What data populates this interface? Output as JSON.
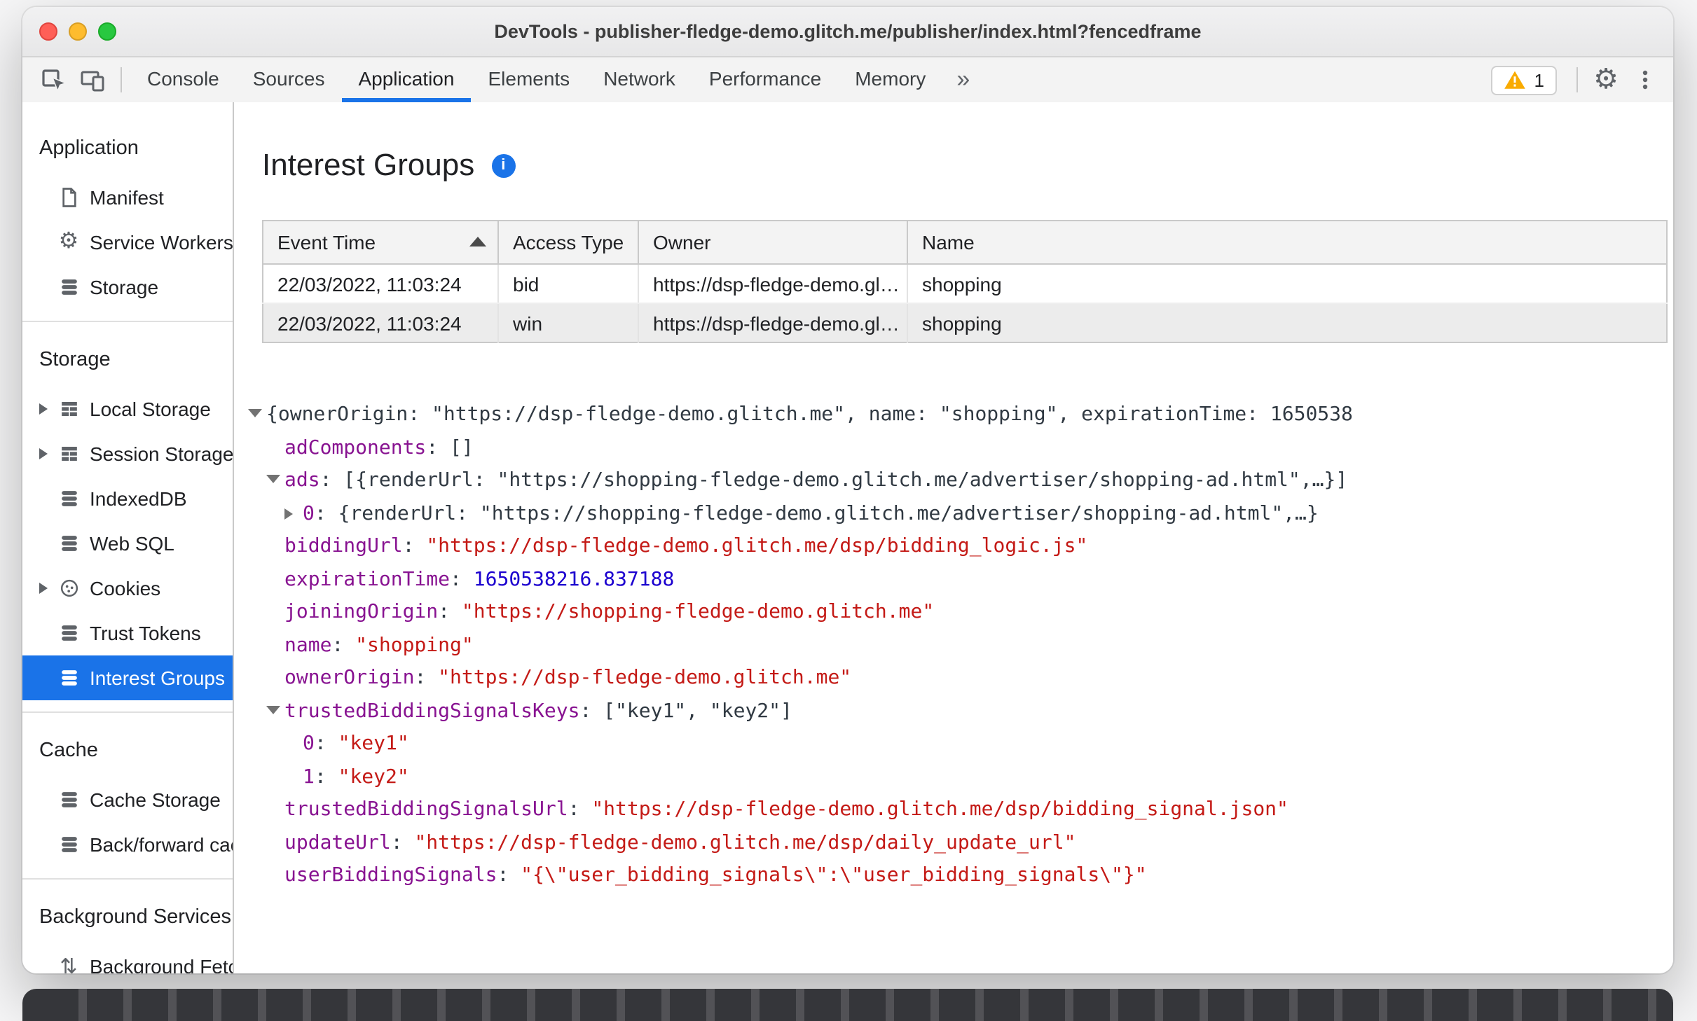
{
  "colors": {
    "accent": "#1a73e8",
    "json_key": "#881391",
    "json_string": "#c41a16",
    "json_number": "#1c00cf",
    "warning": "#f9ab00"
  },
  "window": {
    "title": "DevTools - publisher-fledge-demo.glitch.me/publisher/index.html?fencedframe"
  },
  "toolbar": {
    "tabs": [
      {
        "label": "Console"
      },
      {
        "label": "Sources"
      },
      {
        "label": "Application",
        "active": true
      },
      {
        "label": "Elements"
      },
      {
        "label": "Network"
      },
      {
        "label": "Performance"
      },
      {
        "label": "Memory"
      }
    ],
    "more_tabs": "»",
    "warning_count": "1"
  },
  "sidebar": {
    "sections": [
      {
        "title": "Application",
        "items": [
          {
            "label": "Manifest",
            "icon": "manifest"
          },
          {
            "label": "Service Workers",
            "icon": "gear"
          },
          {
            "label": "Storage",
            "icon": "database"
          }
        ]
      },
      {
        "title": "Storage",
        "items": [
          {
            "label": "Local Storage",
            "icon": "table",
            "expander": true
          },
          {
            "label": "Session Storage",
            "icon": "table",
            "expander": true
          },
          {
            "label": "IndexedDB",
            "icon": "database"
          },
          {
            "label": "Web SQL",
            "icon": "database"
          },
          {
            "label": "Cookies",
            "icon": "cookie",
            "expander": true
          },
          {
            "label": "Trust Tokens",
            "icon": "database"
          },
          {
            "label": "Interest Groups",
            "icon": "database",
            "selected": true
          }
        ]
      },
      {
        "title": "Cache",
        "items": [
          {
            "label": "Cache Storage",
            "icon": "database"
          },
          {
            "label": "Back/forward cach",
            "icon": "database"
          }
        ]
      },
      {
        "title": "Background Services",
        "items": [
          {
            "label": "Background Fetch",
            "icon": "fetch"
          }
        ]
      }
    ]
  },
  "main": {
    "heading": "Interest Groups",
    "table": {
      "columns": [
        "Event Time",
        "Access Type",
        "Owner",
        "Name"
      ],
      "sorted_column": "Event Time",
      "sort_direction": "ascending",
      "selected_row_index": 1,
      "rows": [
        [
          "22/03/2022, 11:03:24",
          "bid",
          "https://dsp-fledge-demo.gl…",
          "shopping"
        ],
        [
          "22/03/2022, 11:03:24",
          "win",
          "https://dsp-fledge-demo.gl…",
          "shopping"
        ]
      ]
    },
    "tree": [
      {
        "indent": 0,
        "expander": "down",
        "segments": [
          {
            "t": "plain",
            "v": "{ownerOrigin: \"https://dsp-fledge-demo.glitch.me\", name: \"shopping\", expirationTime: 1650538"
          }
        ]
      },
      {
        "indent": 1,
        "expander": null,
        "segments": [
          {
            "t": "key",
            "v": "adComponents"
          },
          {
            "t": "plain",
            "v": ": []"
          }
        ]
      },
      {
        "indent": 1,
        "expander": "down",
        "segments": [
          {
            "t": "key",
            "v": "ads"
          },
          {
            "t": "plain",
            "v": ": [{renderUrl: \"https://shopping-fledge-demo.glitch.me/advertiser/shopping-ad.html\",…}]"
          }
        ]
      },
      {
        "indent": 2,
        "expander": "right",
        "segments": [
          {
            "t": "key",
            "v": "0"
          },
          {
            "t": "plain",
            "v": ": {renderUrl: \"https://shopping-fledge-demo.glitch.me/advertiser/shopping-ad.html\",…}"
          }
        ]
      },
      {
        "indent": 1,
        "expander": null,
        "segments": [
          {
            "t": "key",
            "v": "biddingUrl"
          },
          {
            "t": "plain",
            "v": ": "
          },
          {
            "t": "string",
            "v": "\"https://dsp-fledge-demo.glitch.me/dsp/bidding_logic.js\""
          }
        ]
      },
      {
        "indent": 1,
        "expander": null,
        "segments": [
          {
            "t": "key",
            "v": "expirationTime"
          },
          {
            "t": "plain",
            "v": ": "
          },
          {
            "t": "number",
            "v": "1650538216.837188"
          }
        ]
      },
      {
        "indent": 1,
        "expander": null,
        "segments": [
          {
            "t": "key",
            "v": "joiningOrigin"
          },
          {
            "t": "plain",
            "v": ": "
          },
          {
            "t": "string",
            "v": "\"https://shopping-fledge-demo.glitch.me\""
          }
        ]
      },
      {
        "indent": 1,
        "expander": null,
        "segments": [
          {
            "t": "key",
            "v": "name"
          },
          {
            "t": "plain",
            "v": ": "
          },
          {
            "t": "string",
            "v": "\"shopping\""
          }
        ]
      },
      {
        "indent": 1,
        "expander": null,
        "segments": [
          {
            "t": "key",
            "v": "ownerOrigin"
          },
          {
            "t": "plain",
            "v": ": "
          },
          {
            "t": "string",
            "v": "\"https://dsp-fledge-demo.glitch.me\""
          }
        ]
      },
      {
        "indent": 1,
        "expander": "down",
        "segments": [
          {
            "t": "key",
            "v": "trustedBiddingSignalsKeys"
          },
          {
            "t": "plain",
            "v": ": [\"key1\", \"key2\"]"
          }
        ]
      },
      {
        "indent": 2,
        "expander": null,
        "segments": [
          {
            "t": "key",
            "v": "0"
          },
          {
            "t": "plain",
            "v": ": "
          },
          {
            "t": "string",
            "v": "\"key1\""
          }
        ]
      },
      {
        "indent": 2,
        "expander": null,
        "segments": [
          {
            "t": "key",
            "v": "1"
          },
          {
            "t": "plain",
            "v": ": "
          },
          {
            "t": "string",
            "v": "\"key2\""
          }
        ]
      },
      {
        "indent": 1,
        "expander": null,
        "segments": [
          {
            "t": "key",
            "v": "trustedBiddingSignalsUrl"
          },
          {
            "t": "plain",
            "v": ": "
          },
          {
            "t": "string",
            "v": "\"https://dsp-fledge-demo.glitch.me/dsp/bidding_signal.json\""
          }
        ]
      },
      {
        "indent": 1,
        "expander": null,
        "segments": [
          {
            "t": "key",
            "v": "updateUrl"
          },
          {
            "t": "plain",
            "v": ": "
          },
          {
            "t": "string",
            "v": "\"https://dsp-fledge-demo.glitch.me/dsp/daily_update_url\""
          }
        ]
      },
      {
        "indent": 1,
        "expander": null,
        "segments": [
          {
            "t": "key",
            "v": "userBiddingSignals"
          },
          {
            "t": "plain",
            "v": ": "
          },
          {
            "t": "string",
            "v": "\"{\\\"user_bidding_signals\\\":\\\"user_bidding_signals\\\"}\""
          }
        ]
      }
    ]
  }
}
